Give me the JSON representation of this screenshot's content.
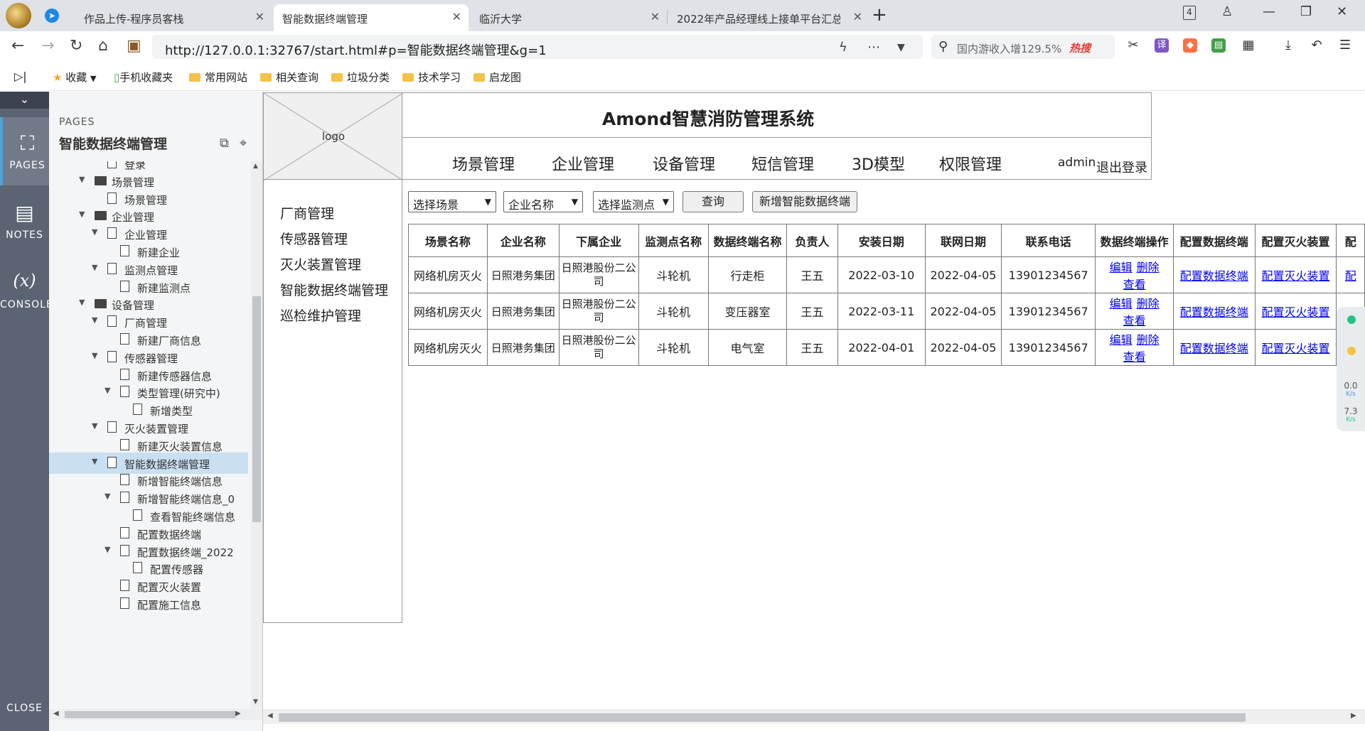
{
  "browser": {
    "tabs": [
      {
        "label": "作品上传-程序员客栈",
        "active": false
      },
      {
        "label": "智能数据终端管理",
        "active": true
      },
      {
        "label": "临沂大学",
        "active": false
      },
      {
        "label": "2022年产品经理线上接单平台汇总",
        "active": false
      }
    ],
    "tab_count_badge": "4",
    "url": "http://127.0.0.1:32767/start.html#p=智能数据终端管理&g=1",
    "search_text": "国内游收入增129.5%",
    "search_hot": "热搜",
    "bookmarks": [
      "收藏",
      "手机收藏夹",
      "常用网站",
      "相关查询",
      "垃圾分类",
      "技术学习",
      "启龙图"
    ]
  },
  "rail": {
    "items": [
      {
        "label": "PAGES",
        "icon": "sitemap-icon"
      },
      {
        "label": "NOTES",
        "icon": "notes-icon"
      },
      {
        "label": "CONSOLE",
        "icon": "console-icon"
      }
    ],
    "close_label": "CLOSE"
  },
  "panel": {
    "section_label": "PAGES",
    "current_page": "智能数据终端管理",
    "tree": [
      {
        "label": "登录",
        "level": 1,
        "type": "page",
        "arrow": false
      },
      {
        "label": "场景管理",
        "level": 0,
        "type": "folder",
        "arrow": true
      },
      {
        "label": "场景管理",
        "level": 1,
        "type": "page",
        "arrow": false
      },
      {
        "label": "企业管理",
        "level": 0,
        "type": "folder",
        "arrow": true
      },
      {
        "label": "企业管理",
        "level": 1,
        "type": "page",
        "arrow": true
      },
      {
        "label": "新建企业",
        "level": 2,
        "type": "page",
        "arrow": false
      },
      {
        "label": "监测点管理",
        "level": 1,
        "type": "page",
        "arrow": true
      },
      {
        "label": "新建监测点",
        "level": 2,
        "type": "page",
        "arrow": false
      },
      {
        "label": "设备管理",
        "level": 0,
        "type": "folder",
        "arrow": true
      },
      {
        "label": "厂商管理",
        "level": 1,
        "type": "page",
        "arrow": true
      },
      {
        "label": "新建厂商信息",
        "level": 2,
        "type": "page",
        "arrow": false
      },
      {
        "label": "传感器管理",
        "level": 1,
        "type": "page",
        "arrow": true
      },
      {
        "label": "新建传感器信息",
        "level": 2,
        "type": "page",
        "arrow": false
      },
      {
        "label": "类型管理(研究中)",
        "level": 2,
        "type": "page",
        "arrow": true
      },
      {
        "label": "新增类型",
        "level": 3,
        "type": "page",
        "arrow": false
      },
      {
        "label": "灭火装置管理",
        "level": 1,
        "type": "page",
        "arrow": true
      },
      {
        "label": "新建灭火装置信息",
        "level": 2,
        "type": "page",
        "arrow": false
      },
      {
        "label": "智能数据终端管理",
        "level": 1,
        "type": "page",
        "arrow": true,
        "selected": true
      },
      {
        "label": "新增智能终端信息",
        "level": 2,
        "type": "page",
        "arrow": false
      },
      {
        "label": "新增智能终端信息_0",
        "level": 2,
        "type": "page",
        "arrow": true
      },
      {
        "label": "查看智能终端信息",
        "level": 3,
        "type": "page",
        "arrow": false
      },
      {
        "label": "配置数据终端",
        "level": 2,
        "type": "page",
        "arrow": false
      },
      {
        "label": "配置数据终端_2022",
        "level": 2,
        "type": "page",
        "arrow": true
      },
      {
        "label": "配置传感器",
        "level": 3,
        "type": "page",
        "arrow": false
      },
      {
        "label": "配置灭火装置",
        "level": 2,
        "type": "page",
        "arrow": false
      },
      {
        "label": "配置施工信息",
        "level": 2,
        "type": "page",
        "arrow": false
      }
    ]
  },
  "app": {
    "logo_label": "logo",
    "title": "Amond智慧消防管理系统",
    "topnav": [
      "场景管理",
      "企业管理",
      "设备管理",
      "短信管理",
      "3D模型",
      "权限管理"
    ],
    "user": "admin",
    "logout": "退出登录",
    "sidenav": [
      "厂商管理",
      "传感器管理",
      "灭火装置管理",
      "智能数据终端管理",
      "巡检维护管理"
    ],
    "filters": {
      "scene": "选择场景",
      "company": "企业名称",
      "monitor_point": "选择监测点",
      "query_button": "查询",
      "add_button": "新增智能数据终端"
    },
    "table": {
      "headers": [
        "场景名称",
        "企业名称",
        "下属企业",
        "监测点名称",
        "数据终端名称",
        "负责人",
        "安装日期",
        "联网日期",
        "联系电话",
        "数据终端操作",
        "配置数据终端",
        "配置灭火装置",
        "配"
      ],
      "action_links": [
        "编辑",
        "删除",
        "查看"
      ],
      "config_terminal_link": "配置数据终端",
      "config_extinguisher_link": "配置灭火装置",
      "last_link": "配",
      "rows": [
        {
          "scene": "网络机房灭火",
          "company": "日照港务集团",
          "sub_company": "日照港股份二公司",
          "monitor": "斗轮机",
          "terminal": "行走柜",
          "owner": "王五",
          "install_date": "2022-03-10",
          "online_date": "2022-04-05",
          "phone": "13901234567"
        },
        {
          "scene": "网络机房灭火",
          "company": "日照港务集团",
          "sub_company": "日照港股份二公司",
          "monitor": "斗轮机",
          "terminal": "变压器室",
          "owner": "王五",
          "install_date": "2022-03-11",
          "online_date": "2022-04-05",
          "phone": "13901234567"
        },
        {
          "scene": "网络机房灭火",
          "company": "日照港务集团",
          "sub_company": "日照港股份二公司",
          "monitor": "斗轮机",
          "terminal": "电气室",
          "owner": "王五",
          "install_date": "2022-04-01",
          "online_date": "2022-04-05",
          "phone": "13901234567"
        }
      ]
    }
  },
  "net_widget": {
    "up": "0.0",
    "up_unit": "K/s",
    "down": "7.3",
    "down_unit": "K/s"
  }
}
